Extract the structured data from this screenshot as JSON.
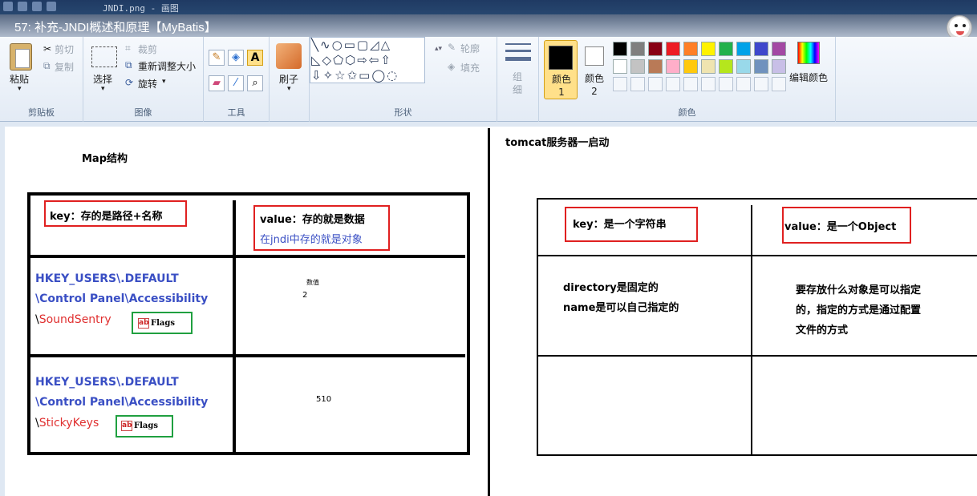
{
  "window": {
    "title_bar": "JNDI.png - 画图",
    "video_title": "57: 补充-JNDI概述和原理【MyBatis】"
  },
  "ribbon": {
    "clipboard": {
      "paste": "粘贴",
      "cut": "剪切",
      "copy": "复制",
      "group": "剪贴板"
    },
    "image": {
      "select": "选择",
      "crop": "裁剪",
      "resize": "重新调整大小",
      "rotate": "旋转",
      "group": "图像"
    },
    "tools": {
      "group": "工具"
    },
    "brushes": {
      "label": "刷子"
    },
    "shapes": {
      "outline": "轮廓",
      "fill": "填充",
      "group": "形状"
    },
    "size": {
      "label": "组细"
    },
    "colors": {
      "color1": "颜色 1",
      "color2": "颜色 2",
      "edit": "编辑颜色",
      "group": "颜色",
      "row1": [
        "#000000",
        "#7f7f7f",
        "#880015",
        "#ed1c24",
        "#ff7f27",
        "#fff200",
        "#22b14c",
        "#00a2e8",
        "#3f48cc",
        "#a349a4"
      ],
      "row2": [
        "#ffffff",
        "#c3c3c3",
        "#b97a57",
        "#ffaec9",
        "#ffc90e",
        "#efe4b0",
        "#b5e61d",
        "#99d9ea",
        "#7092be",
        "#c8bfe7"
      ]
    }
  },
  "left": {
    "heading": "Map结构",
    "key_header": "key：存的是路径+名称",
    "value_header_1": "value：存的就是数据",
    "value_header_2": "在jndi中存的就是对象",
    "row1": {
      "path1": "HKEY_USERS\\.DEFAULT",
      "path2": "\\Control Panel\\Accessibility",
      "path3_prefix": "\\",
      "path3_name": "SoundSentry",
      "flag": "Flags",
      "value_small": "数值",
      "value": "2"
    },
    "row2": {
      "path1": "HKEY_USERS\\.DEFAULT",
      "path2": "\\Control Panel\\Accessibility",
      "path3_prefix": "\\",
      "path3_name": "StickyKeys",
      "flag": "Flags",
      "value": "510"
    }
  },
  "right": {
    "heading": "tomcat服务器一启动",
    "key_header": "key：是一个字符串",
    "value_header": "value：是一个Object",
    "key_desc_1": "directory是固定的",
    "key_desc_2": "name是可以自己指定的",
    "value_desc_1": "要存放什么对象是可以指定",
    "value_desc_2": "的，指定的方式是通过配置",
    "value_desc_3": "文件的方式"
  }
}
